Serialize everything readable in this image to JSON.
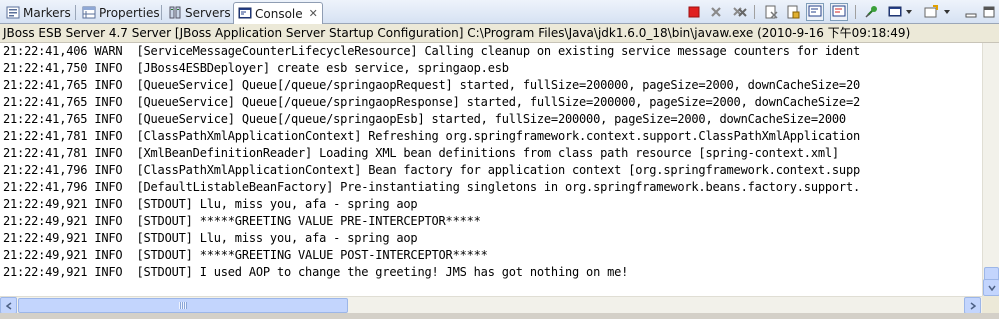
{
  "tabs": [
    {
      "label": "Markers",
      "icon": "markers-icon"
    },
    {
      "label": "Properties",
      "icon": "properties-icon"
    },
    {
      "label": "Servers",
      "icon": "servers-icon"
    },
    {
      "label": "Console",
      "icon": "console-icon",
      "active": true,
      "close": "✕"
    }
  ],
  "toolbar": {
    "buttons": [
      "terminate-icon",
      "remove-launch-icon",
      "remove-all-terminated-icon",
      "clear-console-icon",
      "scroll-lock-icon",
      "word-wrap-icon",
      "show-console-on-stdout-icon",
      "show-console-on-stderr-icon",
      "pin-console-icon",
      "display-selected-console-icon",
      "open-console-icon"
    ],
    "colors": {
      "terminate": "#e02020"
    }
  },
  "console": {
    "title": "JBoss ESB Server 4.7 Server [JBoss Application Server Startup Configuration] C:\\Program Files\\Java\\jdk1.6.0_18\\bin\\javaw.exe (2010-9-16 下午09:18:49)",
    "lines": [
      "21:22:41,406 WARN  [ServiceMessageCounterLifecycleResource] Calling cleanup on existing service message counters for ident",
      "21:22:41,750 INFO  [JBoss4ESBDeployer] create esb service, springaop.esb",
      "21:22:41,765 INFO  [QueueService] Queue[/queue/springaopRequest] started, fullSize=200000, pageSize=2000, downCacheSize=20",
      "21:22:41,765 INFO  [QueueService] Queue[/queue/springaopResponse] started, fullSize=200000, pageSize=2000, downCacheSize=2",
      "21:22:41,765 INFO  [QueueService] Queue[/queue/springaopEsb] started, fullSize=200000, pageSize=2000, downCacheSize=2000",
      "21:22:41,781 INFO  [ClassPathXmlApplicationContext] Refreshing org.springframework.context.support.ClassPathXmlApplication",
      "21:22:41,781 INFO  [XmlBeanDefinitionReader] Loading XML bean definitions from class path resource [spring-context.xml]",
      "21:22:41,796 INFO  [ClassPathXmlApplicationContext] Bean factory for application context [org.springframework.context.supp",
      "21:22:41,796 INFO  [DefaultListableBeanFactory] Pre-instantiating singletons in org.springframework.beans.factory.support.",
      "21:22:49,921 INFO  [STDOUT] Llu, miss you, afa - spring aop",
      "21:22:49,921 INFO  [STDOUT] *****GREETING VALUE PRE-INTERCEPTOR*****",
      "21:22:49,921 INFO  [STDOUT] Llu, miss you, afa - spring aop",
      "21:22:49,921 INFO  [STDOUT] *****GREETING VALUE POST-INTERCEPTOR*****",
      "21:22:49,921 INFO  [STDOUT] I used AOP to change the greeting! JMS has got nothing on me!"
    ]
  }
}
